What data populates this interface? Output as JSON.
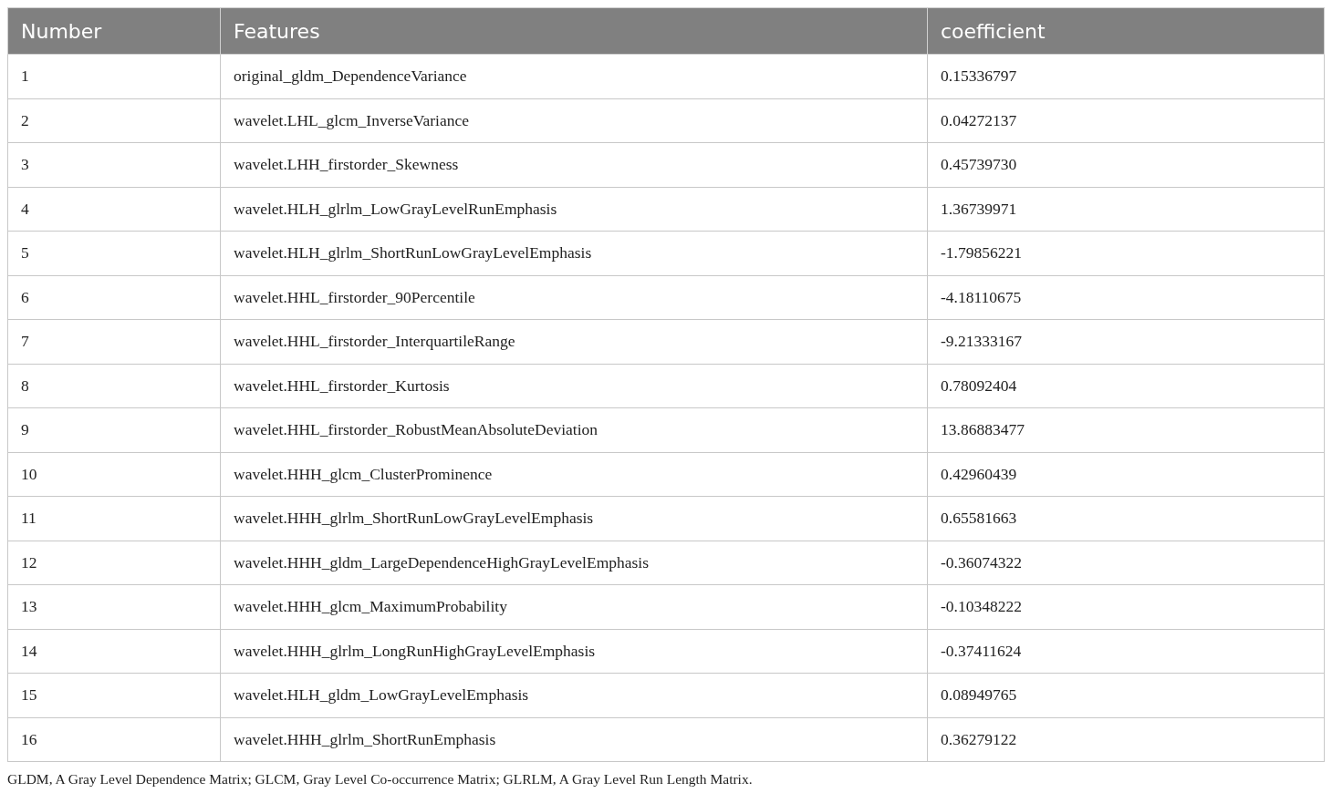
{
  "table": {
    "columns": [
      "Number",
      "Features",
      "coefficient"
    ],
    "rows": [
      [
        "1",
        "original_gldm_DependenceVariance",
        "0.15336797"
      ],
      [
        "2",
        "wavelet.LHL_glcm_InverseVariance",
        "0.04272137"
      ],
      [
        "3",
        "wavelet.LHH_firstorder_Skewness",
        "0.45739730"
      ],
      [
        "4",
        "wavelet.HLH_glrlm_LowGrayLevelRunEmphasis",
        "1.36739971"
      ],
      [
        "5",
        "wavelet.HLH_glrlm_ShortRunLowGrayLevelEmphasis",
        "-1.79856221"
      ],
      [
        "6",
        "wavelet.HHL_firstorder_90Percentile",
        "-4.18110675"
      ],
      [
        "7",
        "wavelet.HHL_firstorder_InterquartileRange",
        "-9.21333167"
      ],
      [
        "8",
        "wavelet.HHL_firstorder_Kurtosis",
        "0.78092404"
      ],
      [
        "9",
        "wavelet.HHL_firstorder_RobustMeanAbsoluteDeviation",
        "13.86883477"
      ],
      [
        "10",
        "wavelet.HHH_glcm_ClusterProminence",
        "0.42960439"
      ],
      [
        "11",
        "wavelet.HHH_glrlm_ShortRunLowGrayLevelEmphasis",
        "0.65581663"
      ],
      [
        "12",
        "wavelet.HHH_gldm_LargeDependenceHighGrayLevelEmphasis",
        "-0.36074322"
      ],
      [
        "13",
        "wavelet.HHH_glcm_MaximumProbability",
        "-0.10348222"
      ],
      [
        "14",
        "wavelet.HHH_glrlm_LongRunHighGrayLevelEmphasis",
        "-0.37411624"
      ],
      [
        "15",
        "wavelet.HLH_gldm_LowGrayLevelEmphasis",
        "0.08949765"
      ],
      [
        "16",
        "wavelet.HHH_glrlm_ShortRunEmphasis",
        "0.36279122"
      ]
    ]
  },
  "footnote": "GLDM, A Gray Level Dependence Matrix; GLCM, Gray Level Co-occurrence Matrix; GLRLM, A Gray Level Run Length Matrix."
}
